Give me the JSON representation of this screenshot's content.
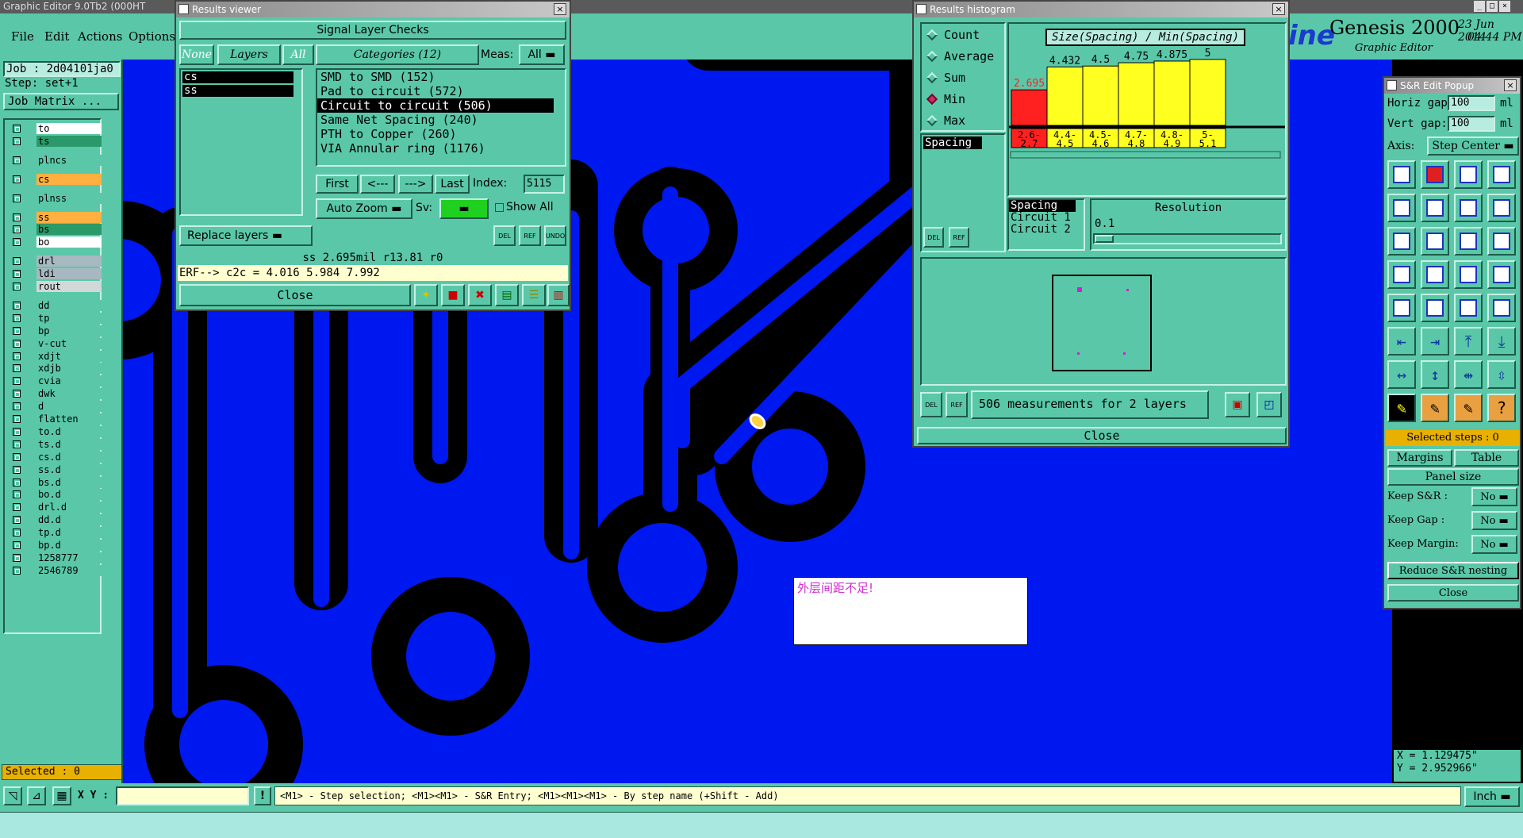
{
  "app": {
    "title": "Graphic Editor 9.0Tb2 (000HT",
    "brand": "Genesis 2000",
    "brand_sub": "Graphic Editor",
    "brand_left": "ine",
    "date": "23 Jun 2014",
    "time": "04:44 PM"
  },
  "menu": {
    "file": "File",
    "edit": "Edit",
    "actions": "Actions",
    "options": "Options"
  },
  "left": {
    "job": "Job : 2d04101ja0",
    "step": "Step: set+1",
    "job_matrix": "Job Matrix ...",
    "selected": "Selected : 0",
    "layers": [
      {
        "name": "to",
        "color": "#ffffff"
      },
      {
        "name": "ts",
        "color": "#2a9a6a"
      },
      {
        "name": "plncs",
        "color": "#5ac8a8"
      },
      {
        "name": "cs",
        "color": "#ffb040"
      },
      {
        "name": "plnss",
        "color": "#5ac8a8"
      },
      {
        "name": "ss",
        "color": "#ffb040"
      },
      {
        "name": "bs",
        "color": "#2a9a6a"
      },
      {
        "name": "bo",
        "color": "#ffffff"
      },
      {
        "name": "drl",
        "color": "#a8b8c0"
      },
      {
        "name": "ldi",
        "color": "#a8b8c0"
      },
      {
        "name": "rout",
        "color": "#d0d8d8"
      },
      {
        "name": "dd",
        "color": "#5ac8a8"
      },
      {
        "name": "tp",
        "color": "#5ac8a8"
      },
      {
        "name": "bp",
        "color": "#5ac8a8"
      },
      {
        "name": "v-cut",
        "color": "#5ac8a8"
      },
      {
        "name": "xdjt",
        "color": "#5ac8a8"
      },
      {
        "name": "xdjb",
        "color": "#5ac8a8"
      },
      {
        "name": "cvia",
        "color": "#5ac8a8"
      },
      {
        "name": "dwk",
        "color": "#5ac8a8"
      },
      {
        "name": "d",
        "color": "#5ac8a8"
      },
      {
        "name": "flatten",
        "color": "#5ac8a8"
      },
      {
        "name": "to.d",
        "color": "#5ac8a8"
      },
      {
        "name": "ts.d",
        "color": "#5ac8a8"
      },
      {
        "name": "cs.d",
        "color": "#5ac8a8"
      },
      {
        "name": "ss.d",
        "color": "#5ac8a8"
      },
      {
        "name": "bs.d",
        "color": "#5ac8a8"
      },
      {
        "name": "bo.d",
        "color": "#5ac8a8"
      },
      {
        "name": "drl.d",
        "color": "#5ac8a8"
      },
      {
        "name": "dd.d",
        "color": "#5ac8a8"
      },
      {
        "name": "tp.d",
        "color": "#5ac8a8"
      },
      {
        "name": "bp.d",
        "color": "#5ac8a8"
      },
      {
        "name": "1258777",
        "color": "#5ac8a8"
      },
      {
        "name": "2546789",
        "color": "#5ac8a8"
      }
    ]
  },
  "results_viewer": {
    "title": "Results viewer",
    "header": "Signal Layer Checks",
    "none": "None",
    "layers": "Layers",
    "all": "All",
    "layer_list": [
      "cs",
      "ss"
    ],
    "categories": "Categories (12)",
    "meas_label": "Meas:",
    "meas_value": "All",
    "category_list": [
      "SMD to SMD (152)",
      "Pad to circuit (572)",
      "Circuit to circuit (506)",
      "Same Net Spacing (240)",
      "PTH to Copper (260)",
      "VIA Annular ring (1176)"
    ],
    "selected_category": "Circuit to circuit (506)",
    "first": "First",
    "prev": "<---",
    "next": "--->",
    "last": "Last",
    "index_label": "Index:",
    "index_value": "5115",
    "auto_zoom": "Auto Zoom",
    "sv": "Sv:",
    "show_all": "Show All",
    "replace_layers": "Replace layers",
    "del": "DEL",
    "ref": "REF",
    "undo": "UNDO",
    "status": "ss 2.695mil  r13.81  r0",
    "erf": "ERF--> c2c = 4.016 5.984 7.992",
    "close": "Close"
  },
  "histogram": {
    "title": "Results histogram",
    "chart_title": "Size(Spacing) / Min(Spacing)",
    "modes": [
      "Count",
      "Average",
      "Sum",
      "Min",
      "Max"
    ],
    "selected_mode": "Min",
    "spacing_tag": "Spacing",
    "group_list": [
      "Spacing",
      "Circuit 1",
      "Circuit 2"
    ],
    "resolution_label": "Resolution",
    "resolution_value": "0.1",
    "measurements": "506 measurements for 2 layers",
    "close": "Close",
    "del": "DEL",
    "ref": "REF"
  },
  "chart_data": {
    "type": "bar",
    "title": "Size(Spacing) / Min(Spacing)",
    "categories": [
      "2.6-2.7",
      "4.4-4.5",
      "4.5-4.6",
      "4.7-4.8",
      "4.8-4.9",
      "5-5.1"
    ],
    "values": [
      2.695,
      4.432,
      4.5,
      4.75,
      4.875,
      5
    ],
    "value_labels": [
      "2.695",
      "4.432",
      "4.5",
      "4.75",
      "4.875",
      "5"
    ],
    "colors": [
      "#ff2020",
      "#ffff20",
      "#ffff20",
      "#ffff20",
      "#ffff20",
      "#ffff20"
    ],
    "label_colors": [
      "#ff2020",
      "#000000",
      "#000000",
      "#000000",
      "#000000",
      "#000000"
    ],
    "ylim": [
      0,
      5.4
    ]
  },
  "sr_popup": {
    "title": "S&R Edit Popup",
    "horiz_label": "Horiz gap:",
    "horiz_value": "100",
    "horiz_unit": "ml",
    "vert_label": "Vert  gap:",
    "vert_value": "100",
    "vert_unit": "ml",
    "axis_label": "Axis:",
    "axis_value": "Step Center",
    "selected_steps": "Selected steps : 0",
    "margins": "Margins",
    "table": "Table",
    "panel_size": "Panel size",
    "keep_sr": "Keep S&R  :",
    "keep_gap": "Keep Gap    :",
    "keep_margin": "Keep Margin:",
    "no": "No",
    "reduce": "Reduce S&R nesting",
    "close": "Close"
  },
  "canvas": {
    "note": "外层间距不足!",
    "coord_x": "X = 1.129475\"",
    "coord_y": "Y = 2.952966\""
  },
  "bottom": {
    "xy_label": "X Y :",
    "hint": "<M1> - Step selection; <M1><M1> - S&R Entry; <M1><M1><M1> - By step name (+Shift - Add)",
    "units": "Inch"
  },
  "colors": {
    "canvas": "#0018f0",
    "panel": "#5ac8a8",
    "trace": "#000000"
  }
}
